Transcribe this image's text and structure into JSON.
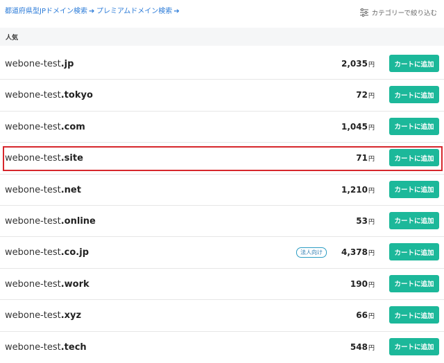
{
  "top_links": [
    {
      "label": "都道府県型JPドメイン検索",
      "arrow": "➔"
    },
    {
      "label": "プレミアムドメイン検索",
      "arrow": "➔"
    }
  ],
  "filter_label": "カテゴリーで絞り込む",
  "section_title": "人気",
  "colors": {
    "accent": "#1cb89a",
    "link": "#2b7bd8",
    "highlight": "#d6262c"
  },
  "rows": [
    {
      "name": "webone-test",
      "tld": ".jp",
      "price": "2,035",
      "yen": "円",
      "button": "カートに追加",
      "badge": ""
    },
    {
      "name": "webone-test",
      "tld": ".tokyo",
      "price": "72",
      "yen": "円",
      "button": "カートに追加",
      "badge": ""
    },
    {
      "name": "webone-test",
      "tld": ".com",
      "price": "1,045",
      "yen": "円",
      "button": "カートに追加",
      "badge": ""
    },
    {
      "name": "webone-test",
      "tld": ".site",
      "price": "71",
      "yen": "円",
      "button": "カートに追加",
      "badge": ""
    },
    {
      "name": "webone-test",
      "tld": ".net",
      "price": "1,210",
      "yen": "円",
      "button": "カートに追加",
      "badge": ""
    },
    {
      "name": "webone-test",
      "tld": ".online",
      "price": "53",
      "yen": "円",
      "button": "カートに追加",
      "badge": ""
    },
    {
      "name": "webone-test",
      "tld": ".co.jp",
      "price": "4,378",
      "yen": "円",
      "button": "カートに追加",
      "badge": "法人向け"
    },
    {
      "name": "webone-test",
      "tld": ".work",
      "price": "190",
      "yen": "円",
      "button": "カートに追加",
      "badge": ""
    },
    {
      "name": "webone-test",
      "tld": ".xyz",
      "price": "66",
      "yen": "円",
      "button": "カートに追加",
      "badge": ""
    },
    {
      "name": "webone-test",
      "tld": ".tech",
      "price": "548",
      "yen": "円",
      "button": "カートに追加",
      "badge": ""
    }
  ]
}
